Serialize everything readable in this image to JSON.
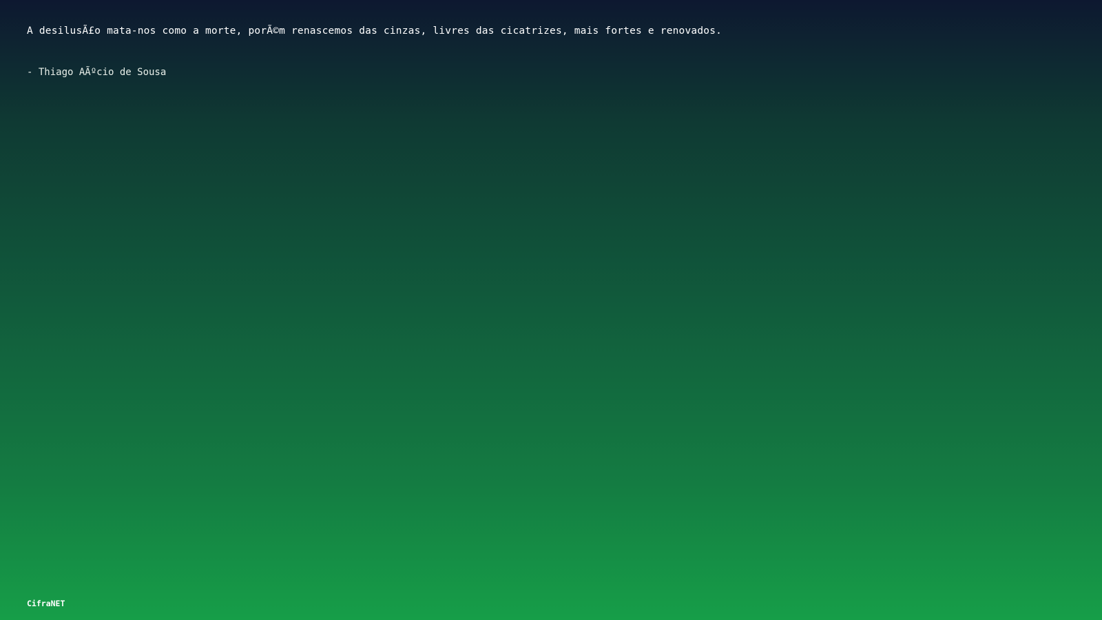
{
  "quote": {
    "text": "A desilusÃ£o mata-nos como a morte, porÃ©m renascemos das cinzas, livres das cicatrizes, mais fortes e renovados.",
    "author": "- Thiago AÃºcio de Sousa"
  },
  "footer": {
    "brand": "CifraNET"
  },
  "colors": {
    "gradient_top": "#0d1830",
    "gradient_bottom": "#169e48",
    "text": "#ffffff"
  }
}
